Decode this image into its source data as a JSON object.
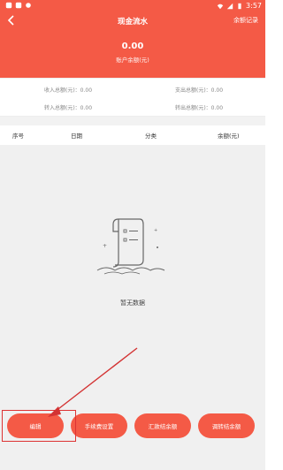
{
  "status_bar": {
    "time": "3:57"
  },
  "header": {
    "title": "现金流水",
    "records_label": "余额记录",
    "balance_value": "0.00",
    "balance_label": "账户余额(元)"
  },
  "stats": [
    {
      "label": "收入总额(元)：0.00"
    },
    {
      "label": "支出总额(元)：0.00"
    },
    {
      "label": "转入总额(元)：0.00"
    },
    {
      "label": "转出总额(元)：0.00"
    }
  ],
  "table": {
    "columns": [
      "序号",
      "日期",
      "分类",
      "余额(元)"
    ]
  },
  "empty": {
    "text": "暂无数据"
  },
  "buttons": [
    {
      "label": "编辑"
    },
    {
      "label": "手续费设置"
    },
    {
      "label": "汇款结余额"
    },
    {
      "label": "调转结余额"
    }
  ],
  "colors": {
    "brand": "#f45a46",
    "annotation": "#d33333"
  }
}
